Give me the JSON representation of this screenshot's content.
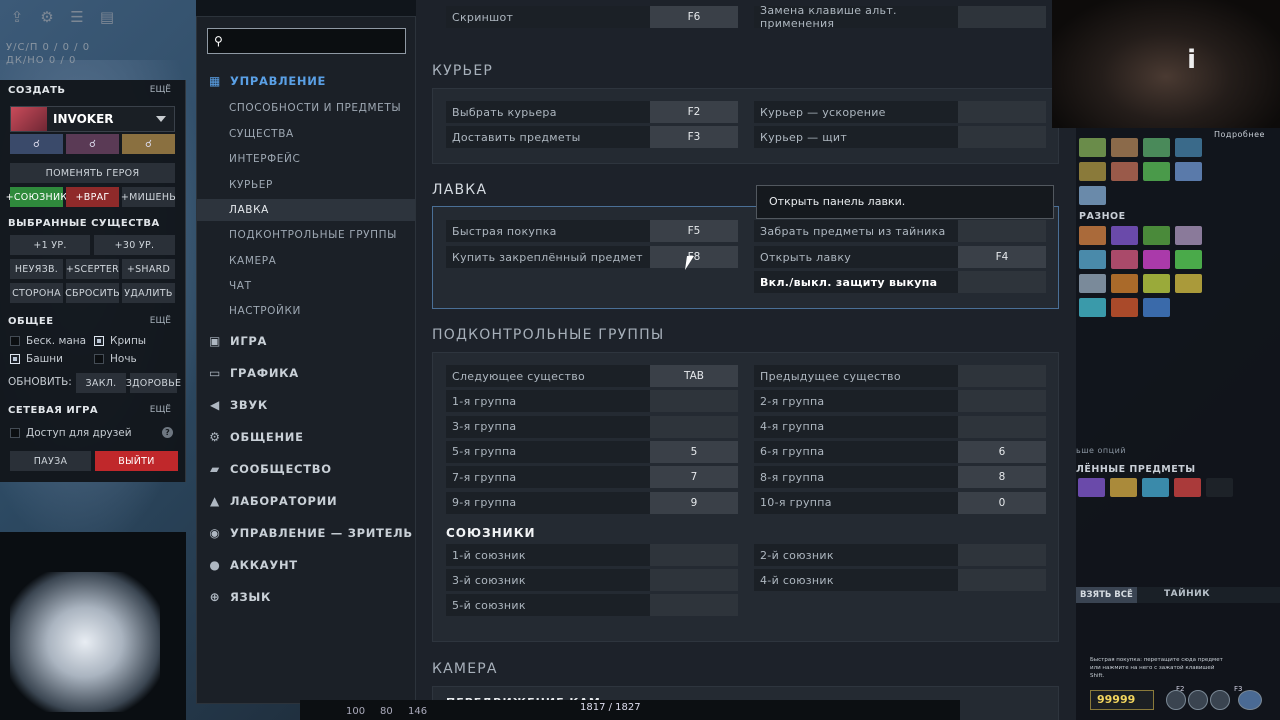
{
  "left_panel": {
    "kda_line1": "У/С/П   0 / 0 / 0",
    "kda_line2": "ДК/НО   0 / 0",
    "create_label": "СОЗДАТЬ",
    "more": "ЕЩЁ",
    "hero_name": "INVOKER",
    "change_hero": "ПОМЕНЯТЬ ГЕРОЯ",
    "ally": "+СОЮЗНИК",
    "enemy": "+ВРАГ",
    "target": "+МИШЕНЬ",
    "selected_units": "ВЫБРАННЫЕ СУЩЕСТВА",
    "lvl1": "+1 УР.",
    "lvl30": "+30 УР.",
    "invuln": "НЕУЯЗВ.",
    "scepter": "+SCEPTER",
    "shard": "+SHARD",
    "side": "СТОРОНА",
    "reset": "СБРОСИТЬ",
    "delete": "УДАЛИТЬ",
    "general": "ОБЩЕЕ",
    "infinite_mana": "Беск. мана",
    "creeps": "Крипы",
    "towers": "Башни",
    "night": "Ночь",
    "refresh": "ОБНОВИТЬ:",
    "spells": "ЗАКЛ.",
    "health": "ЗДОРОВЬЕ",
    "network": "СЕТЕВАЯ ИГРА",
    "friends_access": "Доступ для друзей",
    "help": "?",
    "pause": "ПАУЗА",
    "exit": "ВЫЙТИ"
  },
  "sidebar": {
    "search_placeholder": "",
    "control": "УПРАВЛЕНИЕ",
    "sub": [
      "СПОСОБНОСТИ И ПРЕДМЕТЫ",
      "СУЩЕСТВА",
      "ИНТЕРФЕЙС",
      "КУРЬЕР",
      "ЛАВКА",
      "ПОДКОНТРОЛЬНЫЕ ГРУППЫ",
      "КАМЕРА",
      "ЧАТ",
      "НАСТРОЙКИ"
    ],
    "main": [
      "ИГРА",
      "ГРАФИКА",
      "ЗВУК",
      "ОБЩЕНИЕ",
      "СООБЩЕСТВО",
      "ЛАБОРАТОРИИ",
      "УПРАВЛЕНИЕ — ЗРИТЕЛЬ",
      "АККАУНТ",
      "ЯЗЫК"
    ]
  },
  "content": {
    "top_row": {
      "left_label": "Скриншот",
      "left_key": "F6",
      "right_label": "Замена клавише альт. применения",
      "right_key": ""
    },
    "courier": {
      "title": "КУРЬЕР",
      "rows": [
        {
          "label": "Выбрать курьера",
          "key": "F2"
        },
        {
          "label": "Доставить предметы",
          "key": "F3"
        },
        {
          "label": "Курьер — ускорение",
          "key": ""
        },
        {
          "label": "Курьер — щит",
          "key": ""
        }
      ]
    },
    "shop": {
      "title": "ЛАВКА",
      "rows": [
        {
          "label": "Быстрая покупка",
          "key": "F5"
        },
        {
          "label": "Купить закреплённый предмет",
          "key": "F8"
        },
        {
          "label": "Забрать предметы из тайника",
          "key": ""
        },
        {
          "label": "Открыть лавку",
          "key": "F4"
        },
        {
          "label": "Вкл./выкл. защиту выкупа",
          "key": ""
        }
      ],
      "tooltip": "Открыть панель лавки."
    },
    "groups": {
      "title": "ПОДКОНТРОЛЬНЫЕ ГРУППЫ",
      "left": [
        {
          "label": "Следующее существо",
          "key": "TAB"
        },
        {
          "label": "1-я группа",
          "key": ""
        },
        {
          "label": "3-я группа",
          "key": ""
        },
        {
          "label": "5-я группа",
          "key": "5"
        },
        {
          "label": "7-я группа",
          "key": "7"
        },
        {
          "label": "9-я группа",
          "key": "9"
        }
      ],
      "right": [
        {
          "label": "Предыдущее существо",
          "key": ""
        },
        {
          "label": "2-я группа",
          "key": ""
        },
        {
          "label": "4-я группа",
          "key": ""
        },
        {
          "label": "6-я группа",
          "key": "6"
        },
        {
          "label": "8-я группа",
          "key": "8"
        },
        {
          "label": "10-я группа",
          "key": "0"
        }
      ],
      "allies_title": "СОЮЗНИКИ",
      "allies_left": [
        {
          "label": "1-й союзник",
          "key": ""
        },
        {
          "label": "3-й союзник",
          "key": ""
        },
        {
          "label": "5-й союзник",
          "key": ""
        }
      ],
      "allies_right": [
        {
          "label": "2-й союзник",
          "key": ""
        },
        {
          "label": "4-й союзник",
          "key": ""
        }
      ]
    },
    "camera": {
      "title": "КАМЕРА",
      "first_row": "ПЕРЕДВИЖЕНИЕ КАМ"
    }
  },
  "right": {
    "details": "Подробнее",
    "misc": "РАЗНОЕ",
    "more_options": "ьше опций",
    "pinned": "ЛЁННЫЕ ПРЕДМЕТЫ",
    "take_all": "ВЗЯТЬ ВСЁ",
    "stash": "ТАЙНИК",
    "gold": "99999",
    "quick_buy_hint": "Быстрая покупка: перетащите сюда предмет или нажмите на него с зажатой клавишей Shift.",
    "f2": "F2",
    "f3": "F3"
  },
  "bottom": {
    "hp": "100",
    "mana": "80",
    "value3": "146",
    "xp": "1817 / 1827"
  },
  "colors": {
    "accent_blue": "#5aa0e6",
    "exit_red": "#c0282b",
    "ally_green": "#2f8a3c",
    "enemy_red": "#8f2a2a"
  }
}
